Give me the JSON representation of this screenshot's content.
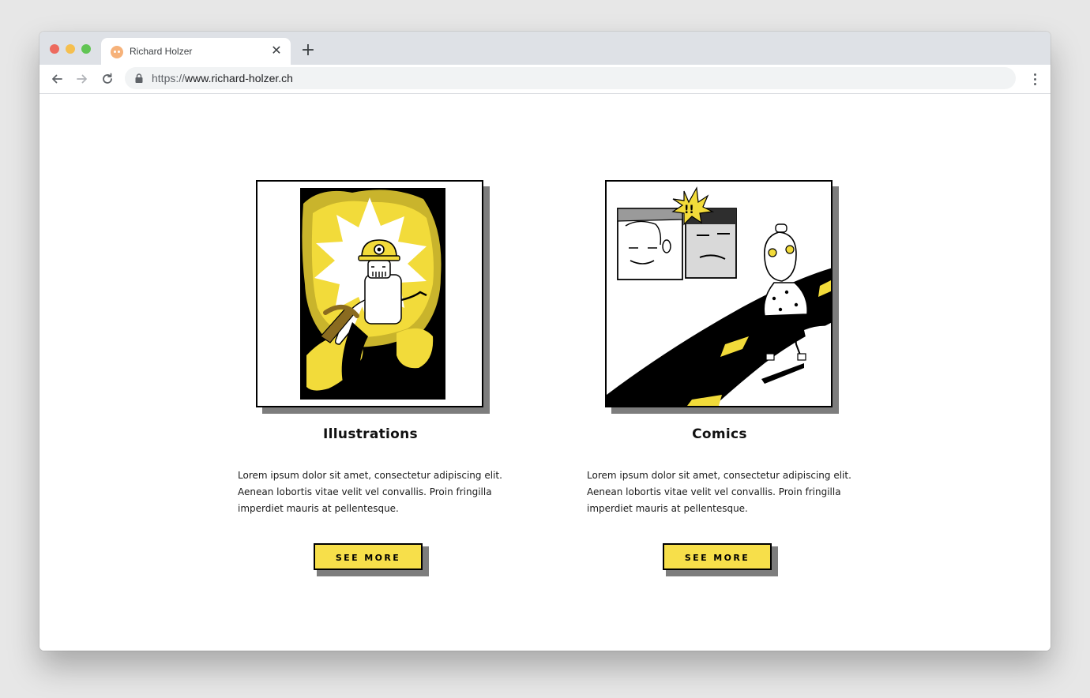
{
  "browser": {
    "tab": {
      "title": "Richard Holzer",
      "favicon": "smile-favicon-icon",
      "close_symbol": "✕"
    },
    "new_tab_symbol": "+",
    "url": {
      "scheme": "https://",
      "host": "www.richard-holzer.ch"
    },
    "icons": {
      "back": "arrow-back-icon",
      "forward": "arrow-forward-icon",
      "reload": "reload-icon",
      "lock": "lock-icon",
      "menu": "more-vertical-icon"
    }
  },
  "colors": {
    "accent_yellow": "#f7df4a",
    "shadow_gray": "#7d7d7d",
    "ink": "#000000"
  },
  "cards": [
    {
      "image": "miner-illustration-image",
      "title": "Illustrations",
      "description": "Lorem ipsum dolor sit amet, consectetur adipiscing elit. Aenean lobortis vitae velit vel convallis. Proin fringilla imperdiet mauris at pellentesque.",
      "button": "SEE MORE"
    },
    {
      "image": "comic-road-image",
      "title": "Comics",
      "description": "Lorem ipsum dolor sit amet, consectetur adipiscing elit. Aenean lobortis vitae velit vel convallis. Proin fringilla imperdiet mauris at pellentesque.",
      "button": "SEE MORE"
    }
  ]
}
